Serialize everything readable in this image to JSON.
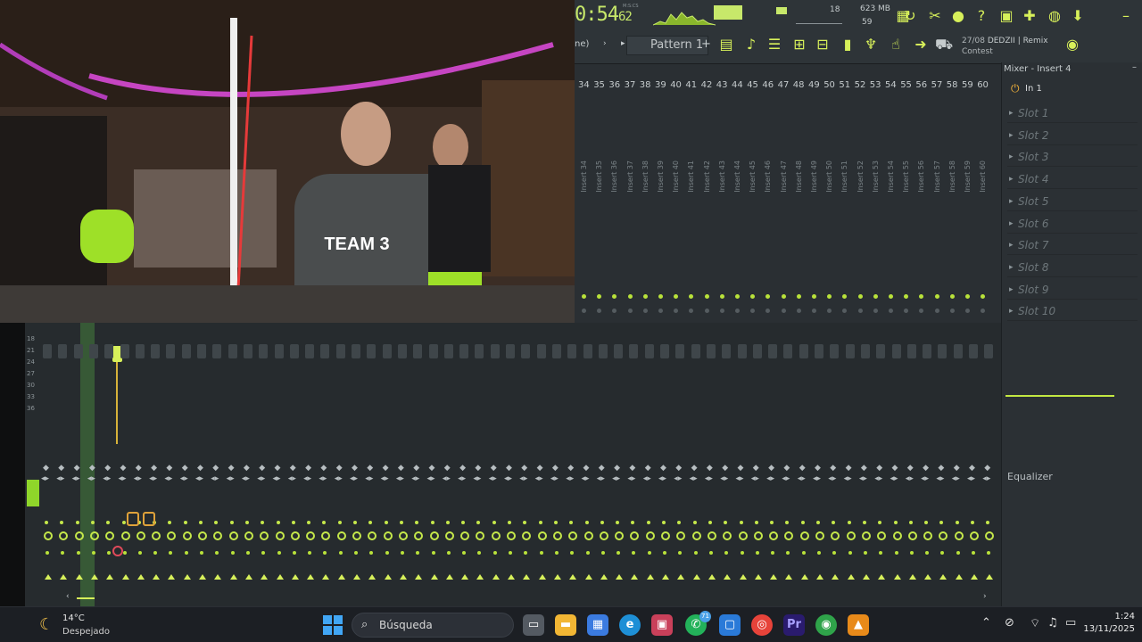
{
  "fl": {
    "time": "0:54",
    "time_frac": "62",
    "time_unit": "M:S:CS",
    "cpu_value": "18",
    "memory": "623 MB",
    "polyphony": "59",
    "pattern": "Pattern 1",
    "song_date": "27/08",
    "song_name": "DEDZII | Remix",
    "song_name2": "Contest",
    "pattern_mode": "ne)"
  },
  "mixer": {
    "panel_title": "Mixer - Insert 4",
    "input": "In 1",
    "slots": [
      "Slot 1",
      "Slot 2",
      "Slot 3",
      "Slot 4",
      "Slot 5",
      "Slot 6",
      "Slot 7",
      "Slot 8",
      "Slot 9",
      "Slot 10"
    ],
    "equalizer_label": "Equalizer",
    "insert_numbers": [
      "34",
      "35",
      "36",
      "37",
      "38",
      "39",
      "40",
      "41",
      "42",
      "43",
      "44",
      "45",
      "46",
      "47",
      "48",
      "49",
      "50",
      "51",
      "52",
      "53",
      "54",
      "55",
      "56",
      "57",
      "58",
      "59",
      "60"
    ],
    "insert_names": [
      "Insert 34",
      "Insert 35",
      "Insert 36",
      "Insert 37",
      "Insert 38",
      "Insert 39",
      "Insert 40",
      "Insert 41",
      "Insert 42",
      "Insert 43",
      "Insert 44",
      "Insert 45",
      "Insert 46",
      "Insert 47",
      "Insert 48",
      "Insert 49",
      "Insert 50",
      "Insert 51",
      "Insert 52",
      "Insert 53",
      "Insert 54",
      "Insert 55",
      "Insert 56",
      "Insert 57",
      "Insert 58",
      "Insert 59",
      "Insert 60"
    ],
    "db_scale": [
      "18",
      "21",
      "24",
      "27",
      "30",
      "33",
      "36"
    ]
  },
  "taskbar": {
    "weather_temp": "14°C",
    "weather_desc": "Despejado",
    "search_placeholder": "Búsqueda",
    "whatsapp_badge": "71",
    "time": "1:24",
    "date": "13/11/2025"
  },
  "colors": {
    "accent": "#d7f05a",
    "panel": "#2a2f33"
  }
}
